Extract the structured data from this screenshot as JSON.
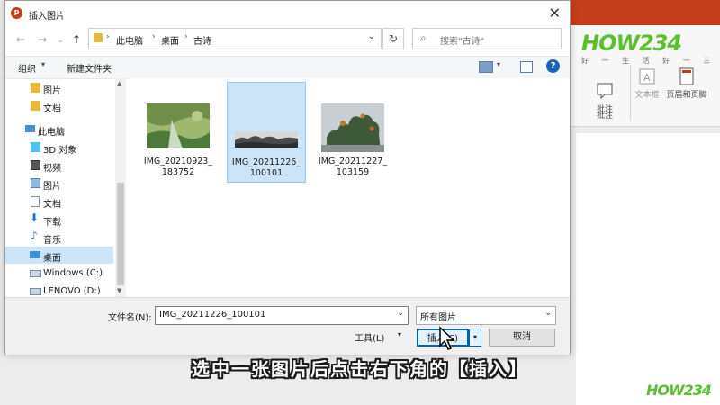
{
  "dialog": {
    "title": "插入图片"
  },
  "address": {
    "crumbs": [
      "此电脑",
      "桌面",
      "古诗"
    ]
  },
  "search": {
    "placeholder": "搜索\"古诗\""
  },
  "toolbar": {
    "organize": "组织",
    "new_folder": "新建文件夹"
  },
  "sidebar": {
    "items": [
      {
        "label": "图片",
        "icon": "folder-icon"
      },
      {
        "label": "文档",
        "icon": "folder-icon"
      },
      {
        "label": "此电脑",
        "icon": "computer-icon"
      },
      {
        "label": "3D 对象",
        "icon": "3d-objects-icon"
      },
      {
        "label": "视频",
        "icon": "video-icon"
      },
      {
        "label": "图片",
        "icon": "pictures-icon"
      },
      {
        "label": "文档",
        "icon": "documents-icon"
      },
      {
        "label": "下载",
        "icon": "download-icon"
      },
      {
        "label": "音乐",
        "icon": "music-icon"
      },
      {
        "label": "桌面",
        "icon": "desktop-icon",
        "selected": true
      },
      {
        "label": "Windows (C:)",
        "icon": "drive-icon"
      },
      {
        "label": "LENOVO (D:)",
        "icon": "drive-icon"
      }
    ]
  },
  "files": [
    {
      "name_line1": "IMG_20210923_",
      "name_line2": "183752",
      "selected": false
    },
    {
      "name_line1": "IMG_20211226_",
      "name_line2": "100101",
      "selected": true
    },
    {
      "name_line1": "IMG_20211227_",
      "name_line2": "103159",
      "selected": false
    }
  ],
  "bottom": {
    "filename_label": "文件名(N):",
    "filename_value": "IMG_20211226_100101",
    "filetype_value": "所有图片",
    "tools_label": "工具(L)",
    "insert_label": "插入(S)",
    "cancel_label": "取消"
  },
  "ppt": {
    "comments_label": "批注",
    "textbox_label": "文本框",
    "header_footer_label": "页眉和页脚",
    "group_comments": "批注"
  },
  "watermark": {
    "logo_text": "HOW234",
    "sub_text": "好 一 生 活 好 一 三"
  },
  "subtitle": "选中一张图片后点击右下角的【插入】",
  "colors": {
    "accent": "#0063b1",
    "ppt_brand": "#c43e1c",
    "selection": "#cce4f7"
  }
}
